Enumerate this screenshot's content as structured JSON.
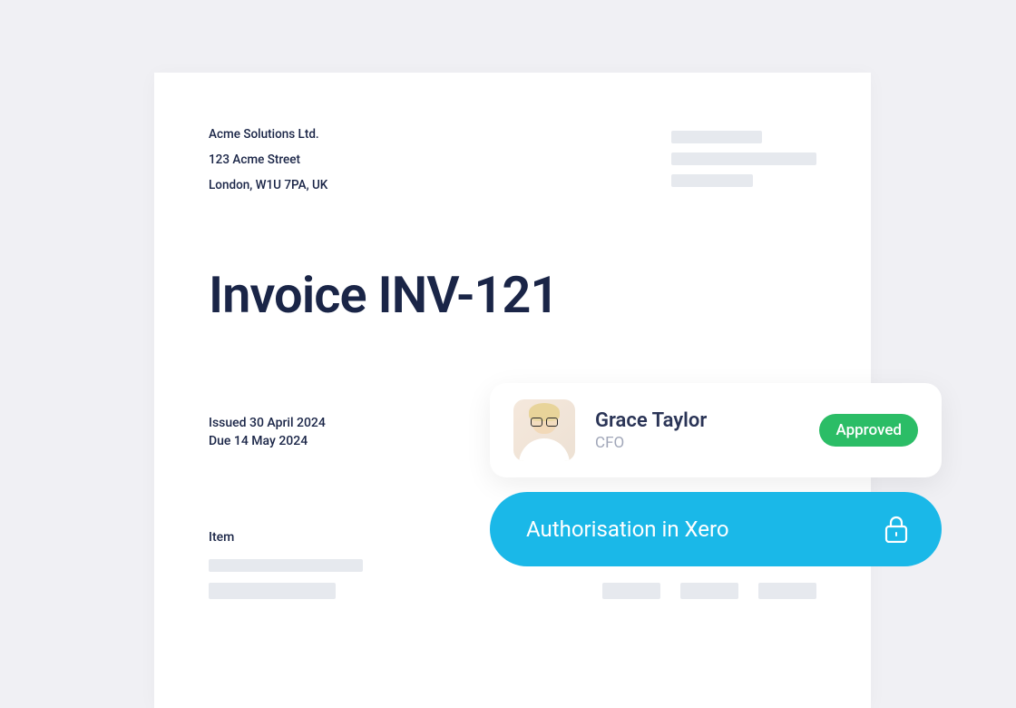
{
  "invoice": {
    "company": {
      "name": "Acme Solutions Ltd.",
      "street": "123 Acme Street",
      "city_line": "London, W1U 7PA, UK"
    },
    "title": "Invoice INV-121",
    "issued": "Issued 30 April 2024",
    "due": "Due 14 May 2024",
    "item_header": "Item"
  },
  "approval": {
    "name": "Grace Taylor",
    "role": "CFO",
    "status": "Approved"
  },
  "auth_button": {
    "label": "Authorisation in Xero"
  }
}
